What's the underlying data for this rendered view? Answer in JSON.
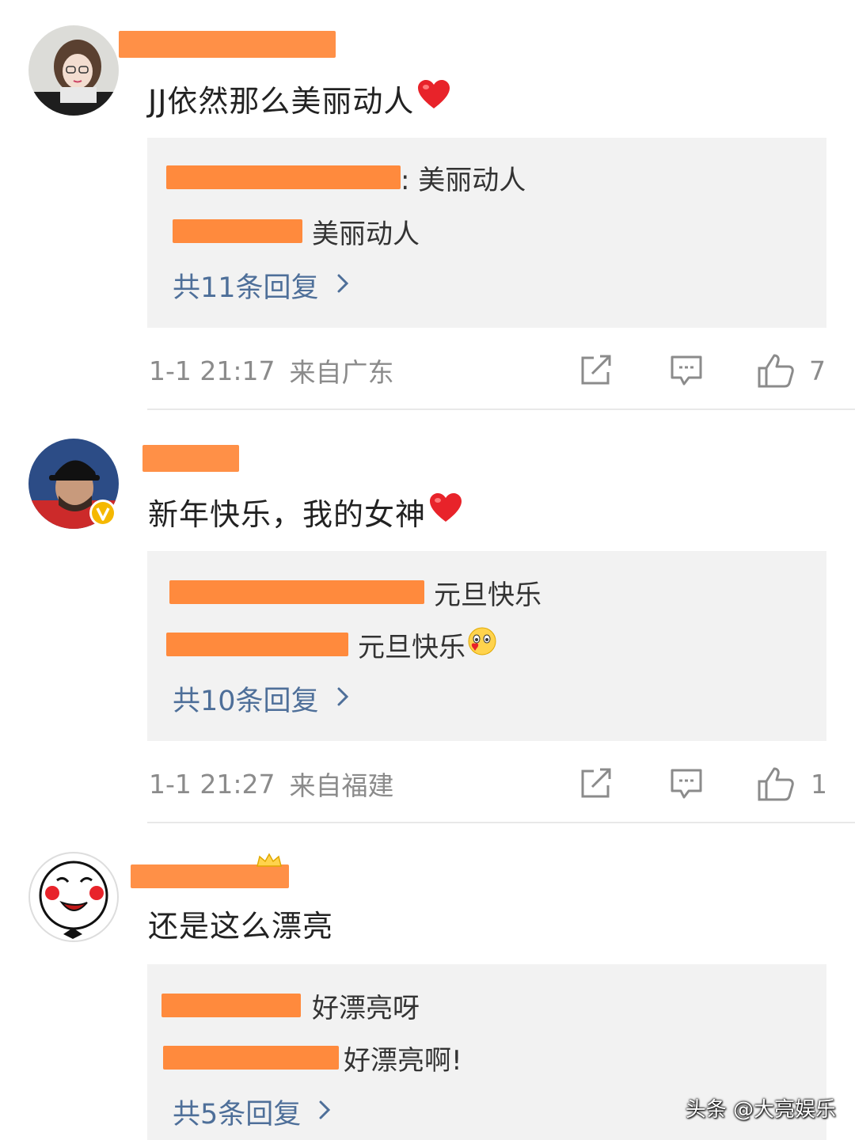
{
  "comments": [
    {
      "text": "JJ依然那么美丽动人",
      "replies": [
        {
          "text": ": 美丽动人"
        },
        {
          "text": "美丽动人"
        }
      ],
      "reply_count_label": "共11条回复",
      "time": "1-1 21:17",
      "location": "来自广东",
      "likes": "7"
    },
    {
      "text": "新年快乐，我的女神",
      "replies": [
        {
          "text": "元旦快乐"
        },
        {
          "text": "元旦快乐"
        }
      ],
      "reply_count_label": "共10条回复",
      "time": "1-1 21:27",
      "location": "来自福建",
      "likes": "1"
    },
    {
      "text": "还是这么漂亮",
      "replies": [
        {
          "text": "好漂亮呀"
        },
        {
          "text": "好漂亮啊!"
        }
      ],
      "reply_count_label": "共5条回复"
    }
  ],
  "watermark": "头条 @大亮娱乐",
  "colors": {
    "redaction": "#ff8a3d",
    "link": "#4e6f99",
    "meta": "#8b8b8b",
    "reply_bg": "#f2f2f2",
    "heart": "#e8232a",
    "verified_badge": "#f5b800"
  },
  "icons": [
    "share-icon",
    "comment-icon",
    "like-icon",
    "chevron-right-icon",
    "heart-emoji",
    "blush-emoji",
    "verified-badge-icon"
  ]
}
